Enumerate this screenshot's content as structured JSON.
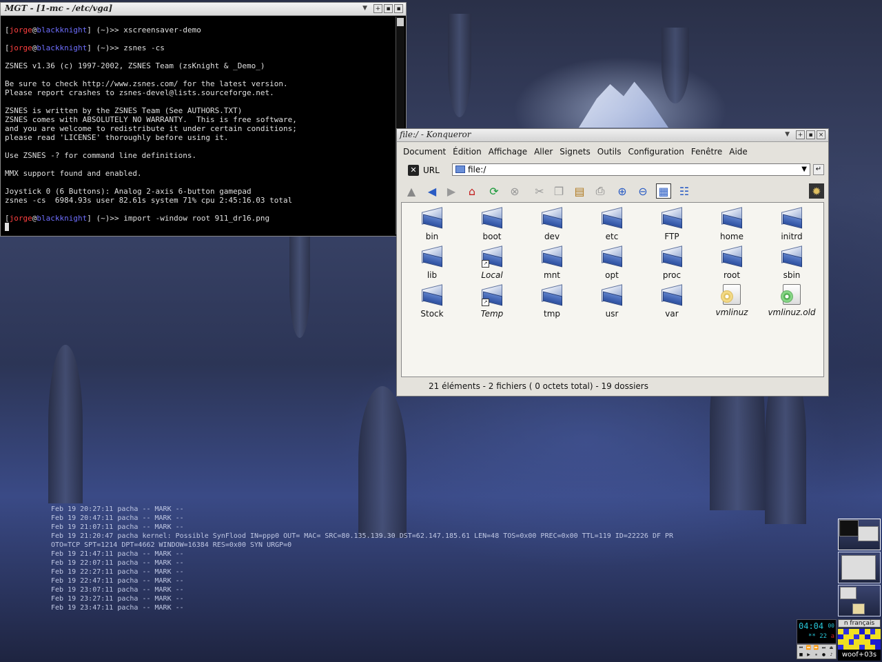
{
  "terminal": {
    "title": "MGT - [1-mc - /etc/vga]",
    "prompt": {
      "user": "jorge",
      "host": "blackknight",
      "dir": "(~)>>"
    },
    "commands": [
      "xscreensaver-demo",
      "zsnes -cs",
      "import -window root 911_dr16.png"
    ],
    "output": [
      "ZSNES v1.36 (c) 1997-2002, ZSNES Team (zsKnight & _Demo_)",
      "",
      "Be sure to check http://www.zsnes.com/ for the latest version.",
      "Please report crashes to zsnes-devel@lists.sourceforge.net.",
      "",
      "ZSNES is written by the ZSNES Team (See AUTHORS.TXT)",
      "ZSNES comes with ABSOLUTELY NO WARRANTY.  This is free software,",
      "and you are welcome to redistribute it under certain conditions;",
      "please read 'LICENSE' thoroughly before using it.",
      "",
      "Use ZSNES -? for command line definitions.",
      "",
      "MMX support found and enabled.",
      "",
      "Joystick 0 (6 Buttons): Analog 2-axis 6-button gamepad",
      "zsnes -cs  6984.93s user 82.61s system 71% cpu 2:45:16.03 total"
    ]
  },
  "konqueror": {
    "title": "file:/ - Konqueror",
    "menu": [
      "Document",
      "Édition",
      "Affichage",
      "Aller",
      "Signets",
      "Outils",
      "Configuration",
      "Fenêtre",
      "Aide"
    ],
    "url_label": "URL",
    "url_value": "file:/",
    "toolbar_icons": [
      "up-icon",
      "back-icon",
      "forward-icon",
      "home-icon",
      "reload-icon",
      "stop-icon",
      "cut-icon",
      "copy-icon",
      "paste-icon",
      "print-icon",
      "zoom-in-icon",
      "zoom-out-icon",
      "icon-view-icon",
      "detail-view-icon",
      "gear-icon"
    ],
    "items": [
      {
        "name": "bin",
        "kind": "folder"
      },
      {
        "name": "boot",
        "kind": "folder"
      },
      {
        "name": "dev",
        "kind": "folder"
      },
      {
        "name": "etc",
        "kind": "folder"
      },
      {
        "name": "FTP",
        "kind": "folder"
      },
      {
        "name": "home",
        "kind": "folder"
      },
      {
        "name": "initrd",
        "kind": "folder"
      },
      {
        "name": "lib",
        "kind": "folder"
      },
      {
        "name": "Local",
        "kind": "link"
      },
      {
        "name": "mnt",
        "kind": "folder"
      },
      {
        "name": "opt",
        "kind": "folder"
      },
      {
        "name": "proc",
        "kind": "folder"
      },
      {
        "name": "root",
        "kind": "folder"
      },
      {
        "name": "sbin",
        "kind": "folder"
      },
      {
        "name": "Stock",
        "kind": "folder"
      },
      {
        "name": "Temp",
        "kind": "link"
      },
      {
        "name": "tmp",
        "kind": "folder"
      },
      {
        "name": "usr",
        "kind": "folder"
      },
      {
        "name": "var",
        "kind": "folder"
      },
      {
        "name": "vmlinuz",
        "kind": "file-link"
      },
      {
        "name": "vmlinuz.old",
        "kind": "file-link-green"
      }
    ],
    "status": "21 éléments - 2 fichiers ( 0 octets total) - 19 dossiers"
  },
  "syslog": [
    "Feb 19 20:27:11 pacha -- MARK --",
    "Feb 19 20:47:11 pacha -- MARK --",
    "Feb 19 21:07:11 pacha -- MARK --",
    "Feb 19 21:20:47 pacha kernel: Possible SynFlood IN=ppp0 OUT= MAC= SRC=80.135.139.30 DST=62.147.185.61 LEN=48 TOS=0x00 PREC=0x00 TTL=119 ID=22226 DF PR",
    "OTO=TCP SPT=1214 DPT=4662 WINDOW=16384 RES=0x00 SYN URGP=0",
    "Feb 19 21:47:11 pacha -- MARK --",
    "Feb 19 22:07:11 pacha -- MARK --",
    "Feb 19 22:27:11 pacha -- MARK --",
    "Feb 19 22:47:11 pacha -- MARK --",
    "Feb 19 23:07:11 pacha -- MARK --",
    "Feb 19 23:27:11 pacha -- MARK --",
    "Feb 19 23:47:11 pacha -- MARK --"
  ],
  "clock": {
    "time": "04:04",
    "seconds": "00",
    "date": "** 22",
    "indicator": "a"
  },
  "lang_applet": "n français",
  "status_applet": "woof+03s",
  "colors": {
    "prompt_user": "#ff4040",
    "prompt_host": "#6f6fff",
    "clock": "#27c4d6"
  }
}
